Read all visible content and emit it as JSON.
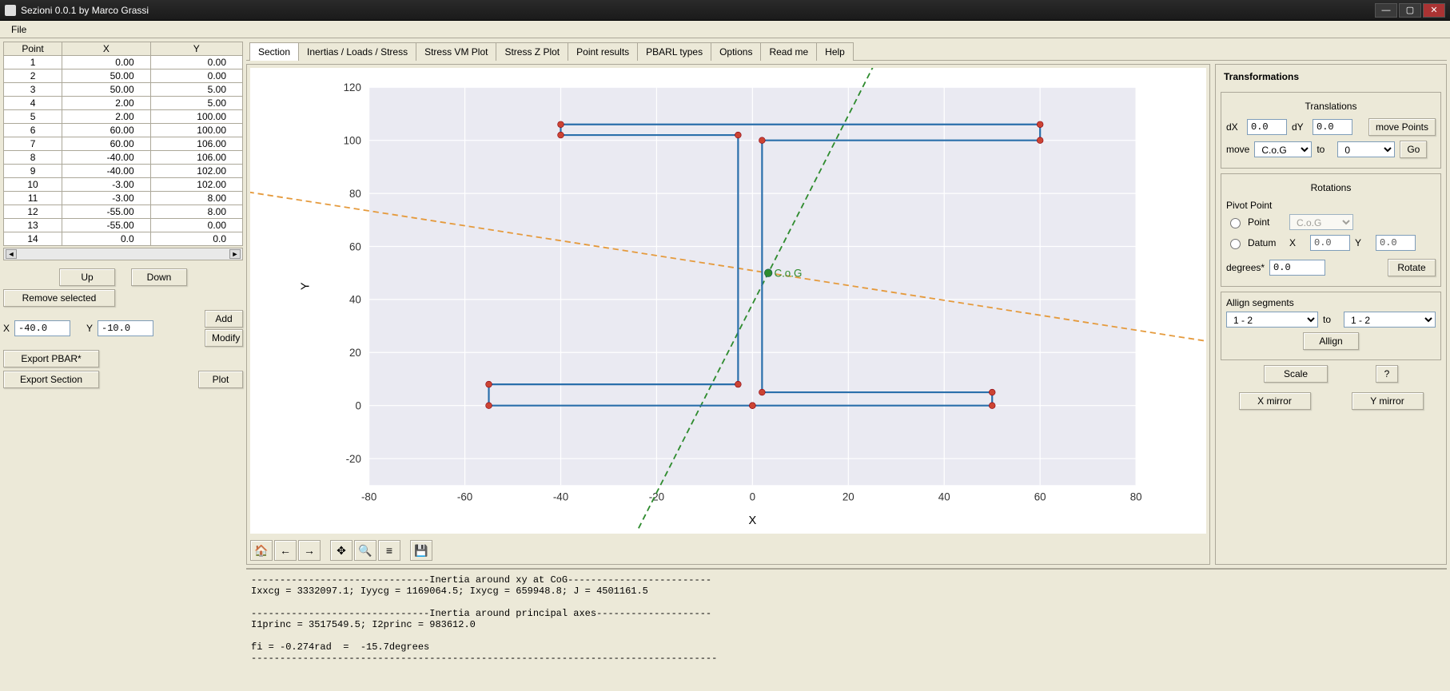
{
  "window": {
    "title": "Sezioni 0.0.1 by Marco Grassi"
  },
  "menubar": {
    "file": "File"
  },
  "left": {
    "columns": {
      "point": "Point",
      "x": "X",
      "y": "Y"
    },
    "rows": [
      {
        "n": "1",
        "x": "0.00",
        "y": "0.00"
      },
      {
        "n": "2",
        "x": "50.00",
        "y": "0.00"
      },
      {
        "n": "3",
        "x": "50.00",
        "y": "5.00"
      },
      {
        "n": "4",
        "x": "2.00",
        "y": "5.00"
      },
      {
        "n": "5",
        "x": "2.00",
        "y": "100.00"
      },
      {
        "n": "6",
        "x": "60.00",
        "y": "100.00"
      },
      {
        "n": "7",
        "x": "60.00",
        "y": "106.00"
      },
      {
        "n": "8",
        "x": "-40.00",
        "y": "106.00"
      },
      {
        "n": "9",
        "x": "-40.00",
        "y": "102.00"
      },
      {
        "n": "10",
        "x": "-3.00",
        "y": "102.00"
      },
      {
        "n": "11",
        "x": "-3.00",
        "y": "8.00"
      },
      {
        "n": "12",
        "x": "-55.00",
        "y": "8.00"
      },
      {
        "n": "13",
        "x": "-55.00",
        "y": "0.00"
      },
      {
        "n": "14",
        "x": "0.0",
        "y": "0.0"
      }
    ],
    "buttons": {
      "up": "Up",
      "down": "Down",
      "remove": "Remove selected",
      "add": "Add",
      "modify": "Modify",
      "export_pbar": "Export PBAR*",
      "export_section": "Export Section",
      "plot": "Plot"
    },
    "x_label": "X",
    "y_label": "Y",
    "x_val": "-40.0",
    "y_val": "-10.0"
  },
  "tabs": [
    "Section",
    "Inertias / Loads / Stress",
    "Stress VM Plot",
    "Stress Z Plot",
    "Point results",
    "PBARL types",
    "Options",
    "Read me",
    "Help"
  ],
  "active_tab": 0,
  "chart_data": {
    "type": "line",
    "title": "",
    "xlabel": "X",
    "ylabel": "Y",
    "xlim": [
      -80,
      80
    ],
    "ylim": [
      -30,
      120
    ],
    "xticks": [
      -80,
      -60,
      -40,
      -20,
      0,
      20,
      40,
      60,
      80
    ],
    "yticks": [
      -20,
      0,
      20,
      40,
      60,
      80,
      100,
      120
    ],
    "polygon": [
      [
        0,
        0
      ],
      [
        50,
        0
      ],
      [
        50,
        5
      ],
      [
        2,
        5
      ],
      [
        2,
        100
      ],
      [
        60,
        100
      ],
      [
        60,
        106
      ],
      [
        -40,
        106
      ],
      [
        -40,
        102
      ],
      [
        -3,
        102
      ],
      [
        -3,
        8
      ],
      [
        -55,
        8
      ],
      [
        -55,
        0
      ],
      [
        0,
        0
      ]
    ],
    "cog_label": "C.o.G",
    "cog": [
      3.3,
      50
    ],
    "principal_angle_deg": -15.7
  },
  "transformations": {
    "heading": "Transformations",
    "translations": {
      "heading": "Translations",
      "dx_label": "dX",
      "dx": "0.0",
      "dy_label": "dY",
      "dy": "0.0",
      "move_points": "move Points",
      "move_label": "move",
      "move_from": "C.o.G",
      "to_label": "to",
      "move_to": "0",
      "go": "Go"
    },
    "rotations": {
      "heading": "Rotations",
      "pivot_heading": "Pivot Point",
      "point_label": "Point",
      "point_select": "C.o.G",
      "datum_label": "Datum",
      "datum_xlabel": "X",
      "datum_x": "0.0",
      "datum_ylabel": "Y",
      "datum_y": "0.0",
      "degrees_label": "degrees*",
      "degrees": "0.0",
      "rotate": "Rotate"
    },
    "align": {
      "heading": "Allign segments",
      "from": "1 - 2",
      "to_label": "to",
      "to": "1 - 2",
      "align": "Allign"
    },
    "scale": "Scale",
    "help": "?",
    "xmirror": "X mirror",
    "ymirror": "Y mirror"
  },
  "log": "-------------------------------Inertia around xy at CoG-------------------------\nIxxcg = 3332097.1; Iyycg = 1169064.5; Ixycg = 659948.8; J = 4501161.5\n\n-------------------------------Inertia around principal axes--------------------\nI1princ = 3517549.5; I2princ = 983612.0\n\nfi = -0.274rad  =  -15.7degrees\n---------------------------------------------------------------------------------"
}
